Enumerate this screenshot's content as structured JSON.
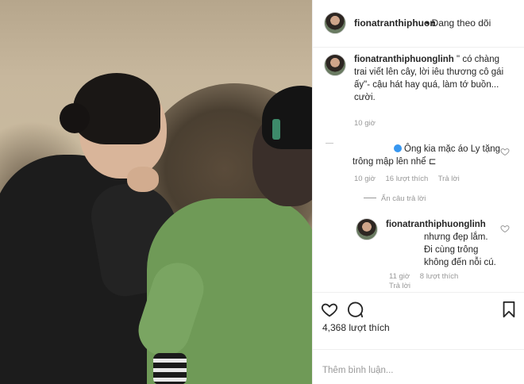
{
  "header": {
    "username": "fionatranthiphuon",
    "follow_status": "• Đang theo dõi"
  },
  "comments": [
    {
      "username": "fionatranthiphuonglinh",
      "text": " \" có chàng trai viết lên cây, lời iêu thương cô gái ấy\"- cậu hát hay quá, làm tớ buồn... cười.",
      "time": "10 giờ"
    },
    {
      "text": "Ông kia mặc áo Ly tặng trông mập lên nhể ⊏",
      "time": "10 giờ",
      "likes": "16 lượt thích",
      "reply": "Trả lời"
    },
    {
      "username": "fionatranthiphuonglinh",
      "text": "nhưng đẹp lắm. Đi cùng trông không đến nỗi cú.",
      "time": "11 giờ",
      "likes": "8 lượt thích",
      "reply": "Trả lời"
    }
  ],
  "hide_replies": "Ẩn câu trả lời",
  "post": {
    "like_count": "4,368 lượt thích",
    "add_comment_placeholder": "Thêm bình luận..."
  },
  "icons": {
    "like": "heart-icon",
    "comment": "comment-icon",
    "save": "bookmark-icon",
    "comment_like": "heart-icon",
    "mention": "verified-badge-icon"
  },
  "colors": {
    "text": "#262626",
    "muted": "#999999",
    "border": "#efefef",
    "link_blue": "#3897f0"
  }
}
